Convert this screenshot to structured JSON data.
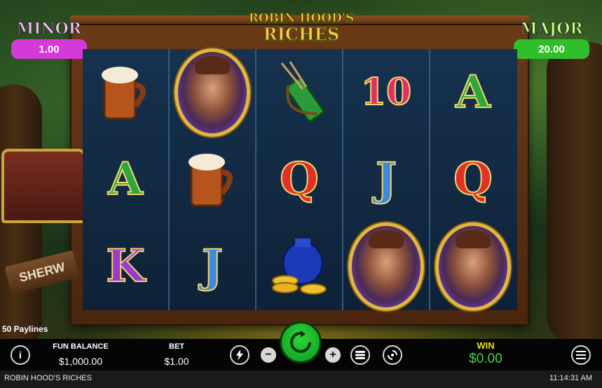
{
  "game": {
    "logo_line1": "ROBIN HOOD'S",
    "logo_line2": "RICHES",
    "sign_text": "SHERW"
  },
  "jackpots": {
    "minor": {
      "name": "MINOR",
      "value": "1.00",
      "color": "#d43ad8"
    },
    "major": {
      "name": "MAJOR",
      "value": "20.00",
      "color": "#2fbf2a"
    }
  },
  "reels": [
    [
      "beer-mug",
      "A",
      "K"
    ],
    [
      "robin-portrait",
      "beer-mug",
      "J"
    ],
    [
      "quiver",
      "Q",
      "coin-bag"
    ],
    [
      "10",
      "J",
      "robin-portrait"
    ],
    [
      "A",
      "Q",
      "robin-portrait"
    ]
  ],
  "controls": {
    "paylines": "50 Paylines",
    "info_label": "i",
    "fun_balance_label": "FUN BALANCE",
    "fun_balance_value": "$1,000.00",
    "bet_label": "BET",
    "bet_value": "$1.00",
    "minus_label": "−",
    "plus_label": "+",
    "win_label": "WIN",
    "win_value": "$0.00"
  },
  "footer": {
    "title": "ROBIN HOOD'S RICHES",
    "time": "11:14:31 AM"
  }
}
